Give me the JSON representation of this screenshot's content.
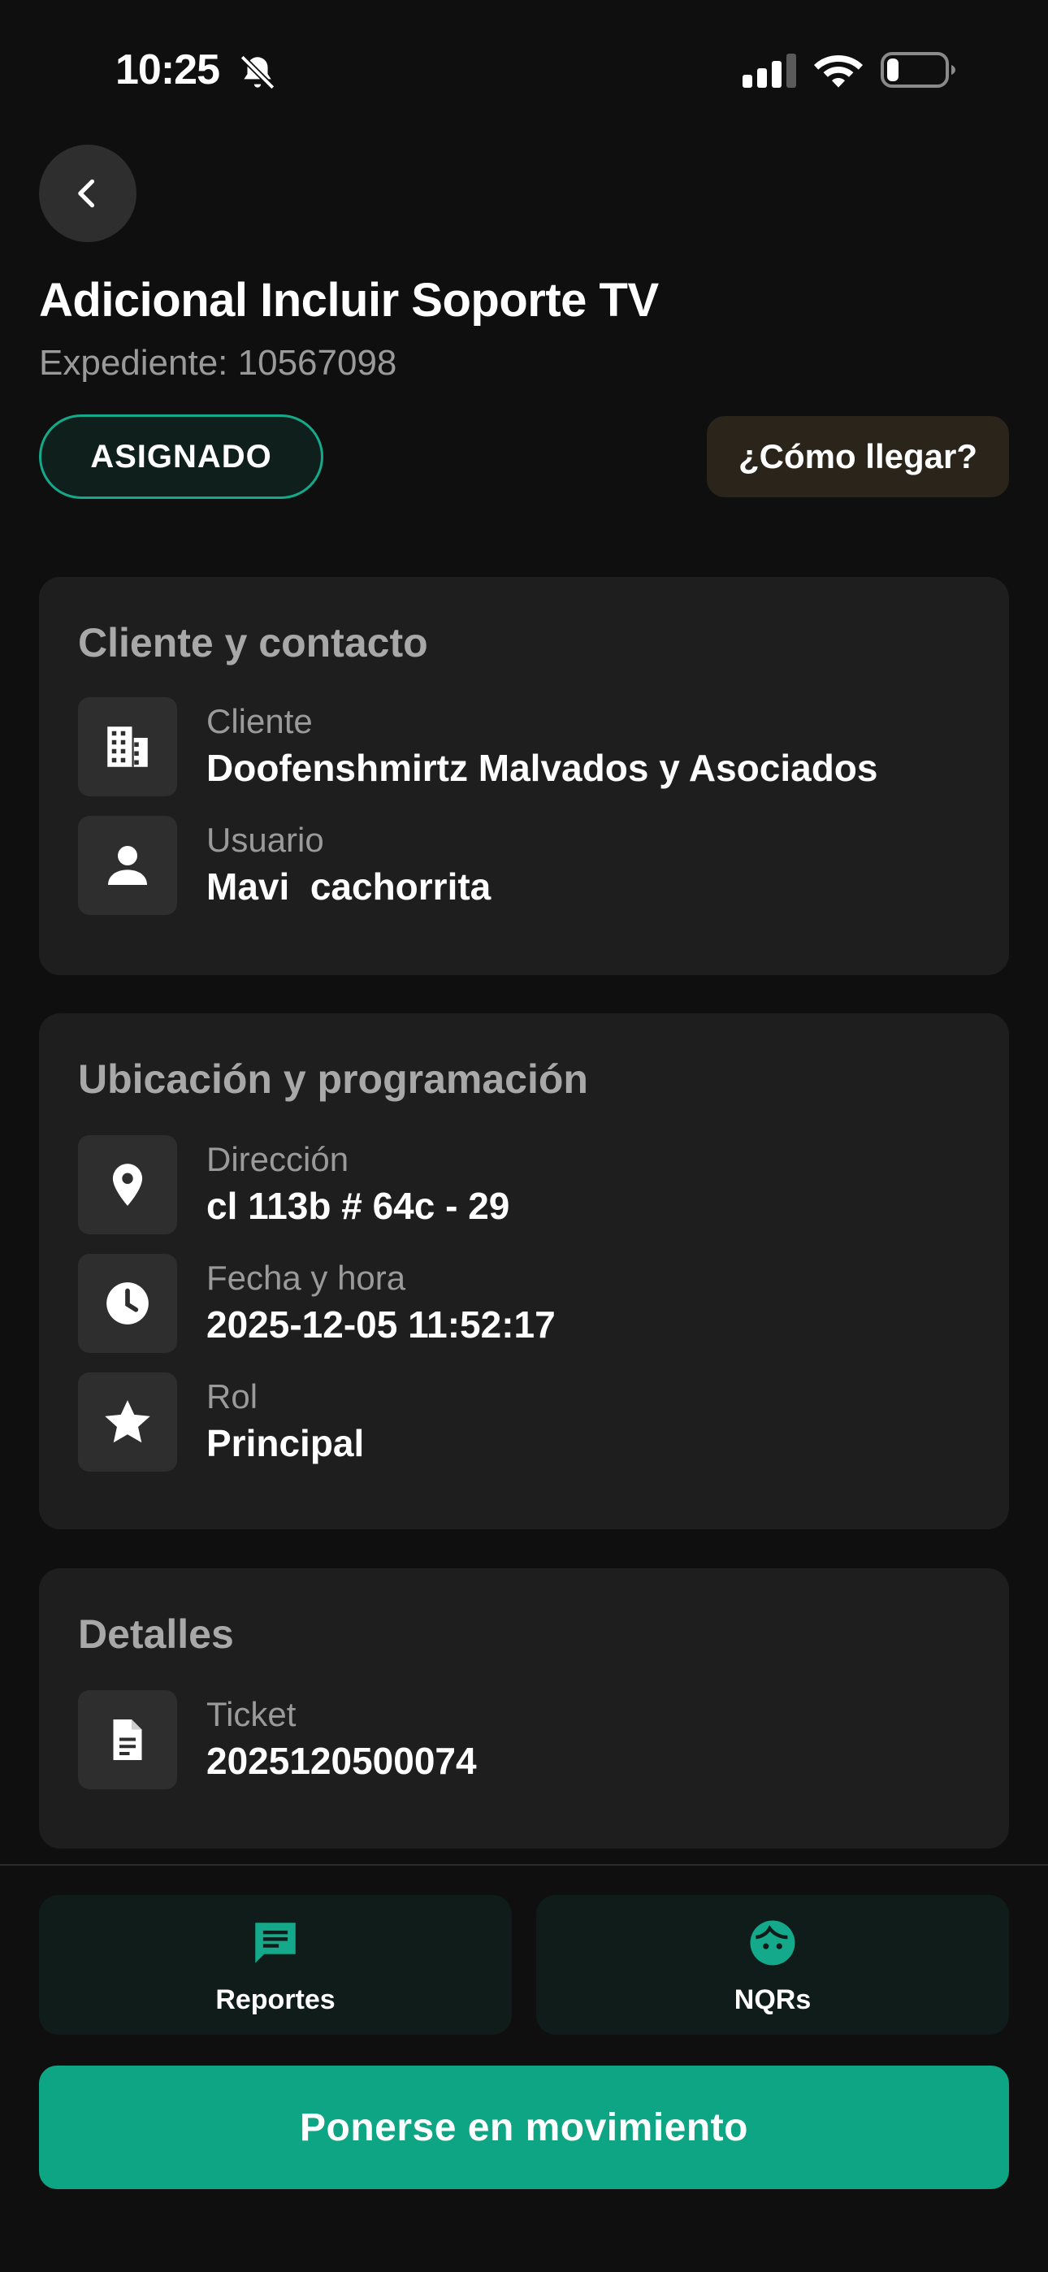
{
  "status_bar": {
    "time": "10:25",
    "icons": [
      "bell-slash-icon",
      "cellular-signal-icon",
      "wifi-icon",
      "battery-icon"
    ]
  },
  "header": {
    "back_icon": "chevron-left-icon",
    "title": "Adicional Incluir Soporte TV",
    "subtitle": "Expediente: 10567098",
    "status_badge": "ASIGNADO",
    "directions_label": "¿Cómo llegar?"
  },
  "cards": {
    "client": {
      "title": "Cliente y contacto",
      "rows": [
        {
          "icon": "building-icon",
          "label": "Cliente",
          "value": "Doofenshmirtz Malvados y Asociados"
        },
        {
          "icon": "person-icon",
          "label": "Usuario",
          "value": "Mavi  cachorrita"
        }
      ]
    },
    "location": {
      "title": "Ubicación y programación",
      "rows": [
        {
          "icon": "location-pin-icon",
          "label": "Dirección",
          "value": "cl 113b # 64c - 29"
        },
        {
          "icon": "clock-icon",
          "label": "Fecha y hora",
          "value": "2025-12-05 11:52:17"
        },
        {
          "icon": "star-icon",
          "label": "Rol",
          "value": "Principal"
        }
      ]
    },
    "details": {
      "title": "Detalles",
      "rows": [
        {
          "icon": "document-icon",
          "label": "Ticket",
          "value": "2025120500074"
        }
      ]
    }
  },
  "bottom": {
    "tabs": [
      {
        "icon": "chat-icon",
        "label": "Reportes"
      },
      {
        "icon": "face-icon",
        "label": "NQRs"
      }
    ],
    "primary_label": "Ponerse en movimiento"
  },
  "colors": {
    "background": "#0f0f0f",
    "card": "#1e1e1e",
    "accent": "#0ea585",
    "badge_border": "#14a98a",
    "muted_text": "#9a9a9a"
  }
}
